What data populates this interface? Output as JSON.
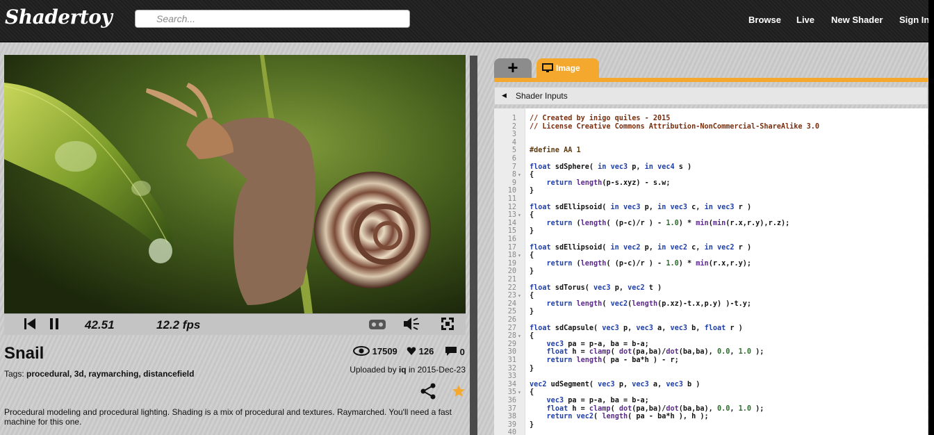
{
  "header": {
    "logo": "Shadertoy",
    "search_placeholder": "Search...",
    "nav": [
      "Browse",
      "Live",
      "New Shader",
      "Sign In"
    ]
  },
  "player": {
    "time": "42.51",
    "fps": "12.2 fps",
    "icons": [
      "rewind-icon",
      "pause-icon",
      "vr-icon",
      "volume-icon",
      "fullscreen-icon"
    ]
  },
  "shader": {
    "title": "Snail",
    "tags_label": "Tags:",
    "tags": "procedural, 3d, raymarching, distancefield",
    "views": "17509",
    "likes": "126",
    "comments": "0",
    "uploaded_prefix": "Uploaded by",
    "author": "iq",
    "uploaded_suffix": "in 2015-Dec-23",
    "description": "Procedural modeling and procedural lighting. Shading is a mix of procedural and textures. Raymarched. You'll need a fast machine for this one."
  },
  "editor": {
    "plus_tab": "+",
    "tab_label": "Image",
    "inputs_label": "Shader Inputs",
    "accent": "#f4a92e",
    "lines": [
      {
        "n": "1",
        "f": "",
        "t": "// Created by inigo quiles - 2015",
        "c": "cm"
      },
      {
        "n": "2",
        "f": "",
        "t": "// License Creative Commons Attribution-NonCommercial-ShareAlike 3.0",
        "c": "cm"
      },
      {
        "n": "3",
        "f": "",
        "t": "",
        "c": ""
      },
      {
        "n": "4",
        "f": "",
        "t": "",
        "c": ""
      },
      {
        "n": "5",
        "f": "",
        "t": "#define AA 1",
        "c": "pp"
      },
      {
        "n": "6",
        "f": "",
        "t": "",
        "c": ""
      },
      {
        "n": "7",
        "f": "",
        "t": "float sdSphere( in vec3 p, in vec4 s )",
        "c": ""
      },
      {
        "n": "8",
        "f": "▾",
        "t": "{",
        "c": ""
      },
      {
        "n": "9",
        "f": "",
        "t": "    return length(p-s.xyz) - s.w;",
        "c": ""
      },
      {
        "n": "10",
        "f": "",
        "t": "}",
        "c": ""
      },
      {
        "n": "11",
        "f": "",
        "t": "",
        "c": ""
      },
      {
        "n": "12",
        "f": "",
        "t": "float sdEllipsoid( in vec3 p, in vec3 c, in vec3 r )",
        "c": ""
      },
      {
        "n": "13",
        "f": "▾",
        "t": "{",
        "c": ""
      },
      {
        "n": "14",
        "f": "",
        "t": "    return (length( (p-c)/r ) - 1.0) * min(min(r.x,r.y),r.z);",
        "c": ""
      },
      {
        "n": "15",
        "f": "",
        "t": "}",
        "c": ""
      },
      {
        "n": "16",
        "f": "",
        "t": "",
        "c": ""
      },
      {
        "n": "17",
        "f": "",
        "t": "float sdEllipsoid( in vec2 p, in vec2 c, in vec2 r )",
        "c": ""
      },
      {
        "n": "18",
        "f": "▾",
        "t": "{",
        "c": ""
      },
      {
        "n": "19",
        "f": "",
        "t": "    return (length( (p-c)/r ) - 1.0) * min(r.x,r.y);",
        "c": ""
      },
      {
        "n": "20",
        "f": "",
        "t": "}",
        "c": ""
      },
      {
        "n": "21",
        "f": "",
        "t": "",
        "c": ""
      },
      {
        "n": "22",
        "f": "",
        "t": "float sdTorus( vec3 p, vec2 t )",
        "c": ""
      },
      {
        "n": "23",
        "f": "▾",
        "t": "{",
        "c": ""
      },
      {
        "n": "24",
        "f": "",
        "t": "    return length( vec2(length(p.xz)-t.x,p.y) )-t.y;",
        "c": ""
      },
      {
        "n": "25",
        "f": "",
        "t": "}",
        "c": ""
      },
      {
        "n": "26",
        "f": "",
        "t": "",
        "c": ""
      },
      {
        "n": "27",
        "f": "",
        "t": "float sdCapsule( vec3 p, vec3 a, vec3 b, float r )",
        "c": ""
      },
      {
        "n": "28",
        "f": "▾",
        "t": "{",
        "c": ""
      },
      {
        "n": "29",
        "f": "",
        "t": "    vec3 pa = p-a, ba = b-a;",
        "c": ""
      },
      {
        "n": "30",
        "f": "",
        "t": "    float h = clamp( dot(pa,ba)/dot(ba,ba), 0.0, 1.0 );",
        "c": ""
      },
      {
        "n": "31",
        "f": "",
        "t": "    return length( pa - ba*h ) - r;",
        "c": ""
      },
      {
        "n": "32",
        "f": "",
        "t": "}",
        "c": ""
      },
      {
        "n": "33",
        "f": "",
        "t": "",
        "c": ""
      },
      {
        "n": "34",
        "f": "",
        "t": "vec2 udSegment( vec3 p, vec3 a, vec3 b )",
        "c": ""
      },
      {
        "n": "35",
        "f": "▾",
        "t": "{",
        "c": ""
      },
      {
        "n": "36",
        "f": "",
        "t": "    vec3 pa = p-a, ba = b-a;",
        "c": ""
      },
      {
        "n": "37",
        "f": "",
        "t": "    float h = clamp( dot(pa,ba)/dot(ba,ba), 0.0, 1.0 );",
        "c": ""
      },
      {
        "n": "38",
        "f": "",
        "t": "    return vec2( length( pa - ba*h ), h );",
        "c": ""
      },
      {
        "n": "39",
        "f": "",
        "t": "}",
        "c": ""
      },
      {
        "n": "40",
        "f": "",
        "t": "",
        "c": ""
      }
    ]
  }
}
